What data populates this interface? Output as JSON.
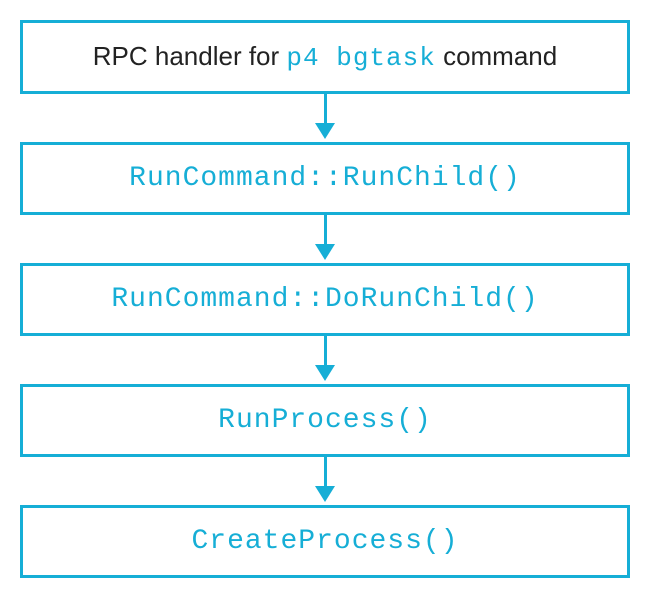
{
  "boxes": {
    "b1_prefix": "RPC handler for ",
    "b1_code": "p4  bgtask",
    "b1_suffix": "  command",
    "b2": "RunCommand::RunChild()",
    "b3": "RunCommand::DoRunChild()",
    "b4": "RunProcess()",
    "b5": "CreateProcess()"
  },
  "colors": {
    "accent": "#16aed6"
  }
}
